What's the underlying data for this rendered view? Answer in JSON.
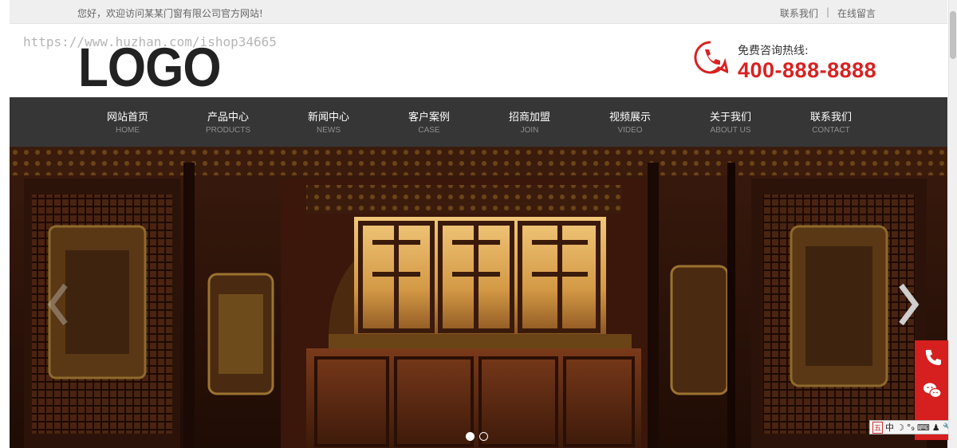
{
  "topbar": {
    "welcome": "您好，欢迎访问某某门窗有限公司官方网站!",
    "links": [
      "联系我们",
      "在线留言"
    ],
    "separator": "|"
  },
  "header": {
    "logo_text": "LOGO",
    "watermark": "https://www.huzhan.com/ishop34665",
    "hotline_label": "免费咨询热线:",
    "hotline_number": "400-888-8888",
    "phone_icon": "phone-bubble-icon"
  },
  "nav": {
    "items": [
      {
        "cn": "网站首页",
        "en": "HOME"
      },
      {
        "cn": "产品中心",
        "en": "PRODUCTS"
      },
      {
        "cn": "新闻中心",
        "en": "NEWS"
      },
      {
        "cn": "客户案例",
        "en": "CASE"
      },
      {
        "cn": "招商加盟",
        "en": "JOIN"
      },
      {
        "cn": "视频展示",
        "en": "VIDEO"
      },
      {
        "cn": "关于我们",
        "en": "ABOUT US"
      },
      {
        "cn": "联系我们",
        "en": "CONTACT"
      }
    ]
  },
  "banner": {
    "slide_count": 2,
    "active_slide": 1,
    "arrow_next_icon": "chevron-right-icon",
    "arrow_prev_icon": "chevron-left-icon"
  },
  "sidebar": {
    "buttons": [
      "phone-icon",
      "wechat-icon",
      "back-to-top-icon"
    ]
  },
  "ime": {
    "items": [
      "五",
      "中",
      "☽",
      "°₉",
      "⌨",
      "♟",
      "🔧"
    ]
  },
  "colors": {
    "accent_red": "#d92121",
    "nav_bg": "#363636",
    "topbar_bg": "#efefef"
  }
}
